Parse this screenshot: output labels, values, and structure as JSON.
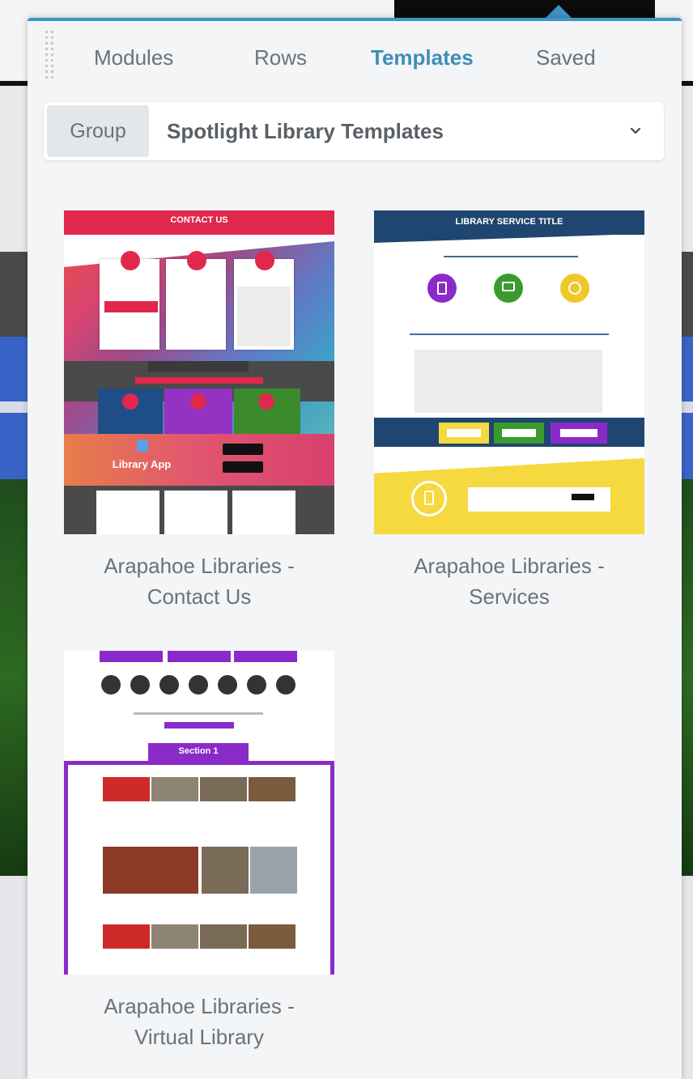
{
  "panel": {
    "tabs": [
      {
        "label": "Modules",
        "active": false
      },
      {
        "label": "Rows",
        "active": false
      },
      {
        "label": "Templates",
        "active": true
      },
      {
        "label": "Saved",
        "active": false
      }
    ],
    "group_select": {
      "label": "Group",
      "value": "Spotlight Library Templates"
    },
    "templates": [
      {
        "title_line1": "Arapahoe Libraries -",
        "title_line2": "Contact Us",
        "thumb": {
          "header": "CONTACT US",
          "app_label": "Library App"
        }
      },
      {
        "title_line1": "Arapahoe Libraries -",
        "title_line2": "Services",
        "thumb": {
          "header": "LIBRARY SERVICE TITLE"
        }
      },
      {
        "title_line1": "Arapahoe Libraries -",
        "title_line2": "Virtual Library",
        "thumb": {
          "section_tab": "Section 1"
        }
      }
    ]
  },
  "colors": {
    "accent": "#3d8fb8",
    "contact_red": "#e2274d",
    "services_navy": "#1f4670",
    "services_yellow": "#f5d93f",
    "virtual_purple": "#8a2bc9"
  }
}
